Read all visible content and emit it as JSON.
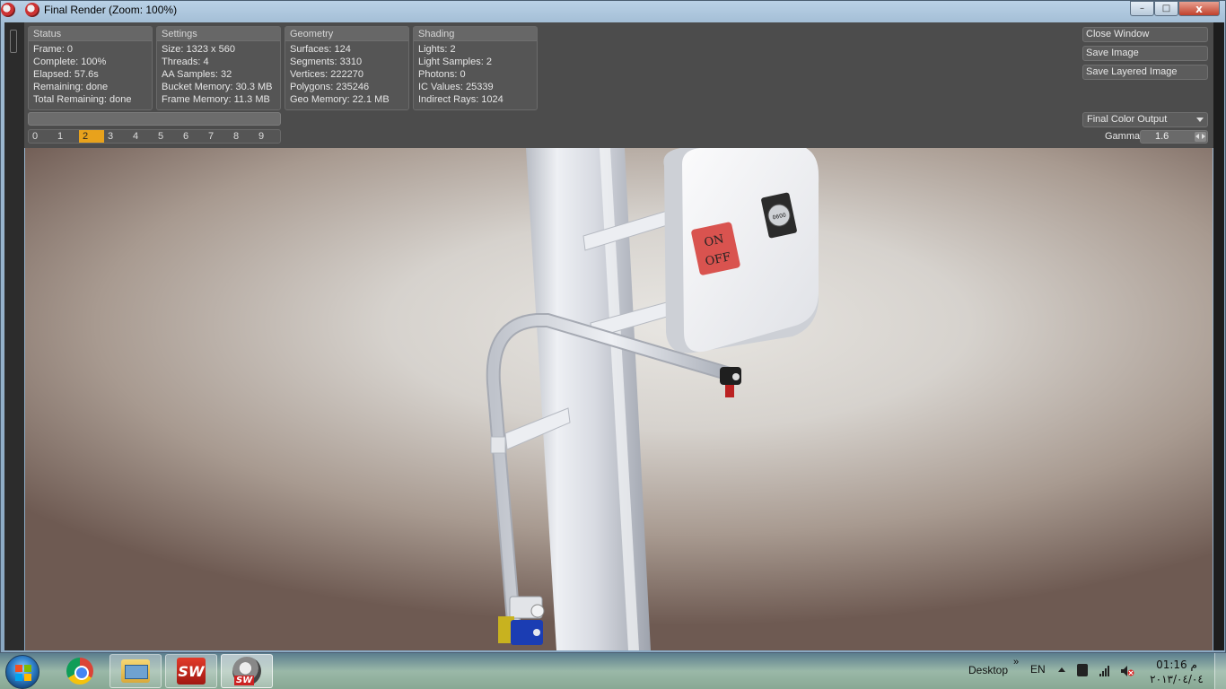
{
  "window": {
    "title": "Final Render (Zoom: 100%)",
    "minimize_label": "–",
    "maximize_label": "□",
    "close_label": "x"
  },
  "status": {
    "header": "Status",
    "frame": "Frame: 0",
    "complete": "Complete: 100%",
    "elapsed": "Elapsed: 57.6s",
    "remaining": "Remaining: done",
    "total_remaining": "Total Remaining: done"
  },
  "settings": {
    "header": "Settings",
    "size": "Size: 1323 x 560",
    "threads": "Threads: 4",
    "aa_samples": "AA Samples: 32",
    "bucket_memory": "Bucket Memory: 30.3 MB",
    "frame_memory": "Frame Memory: 11.3 MB"
  },
  "geometry": {
    "header": "Geometry",
    "surfaces": "Surfaces: 124",
    "segments": "Segments: 3310",
    "vertices": "Vertices: 222270",
    "polygons": "Polygons: 235246",
    "geo_memory": "Geo Memory: 22.1 MB"
  },
  "shading": {
    "header": "Shading",
    "lights": "Lights: 2",
    "light_samples": "Light Samples: 2",
    "photons": "Photons: 0",
    "ic_values": "IC Values: 25339",
    "indirect_rays": "Indirect Rays: 1024"
  },
  "frame_buffers": [
    "0",
    "1",
    "2",
    "3",
    "4",
    "5",
    "6",
    "7",
    "8",
    "9"
  ],
  "selected_buffer": "2",
  "actions": {
    "close_window": "Close Window",
    "save_image": "Save Image",
    "save_layered_image": "Save Layered Image"
  },
  "output": {
    "selected": "Final Color Output",
    "gamma_label": "Gamma",
    "gamma_value": "1.6"
  },
  "render": {
    "sign_on": "ON",
    "sign_off": "OFF",
    "gauge_text": "0600"
  },
  "taskbar": {
    "desktop_label": "Desktop",
    "chevron": "»",
    "language": "EN",
    "time": "01:16 م",
    "date": "٢٠١٣/٠٤/٠٤"
  },
  "colors": {
    "panel_bg": "#4c4c4c",
    "group_bg": "#555555",
    "accent_selected_buffer": "#e8a21c",
    "sign_button_red": "#d9534f"
  }
}
